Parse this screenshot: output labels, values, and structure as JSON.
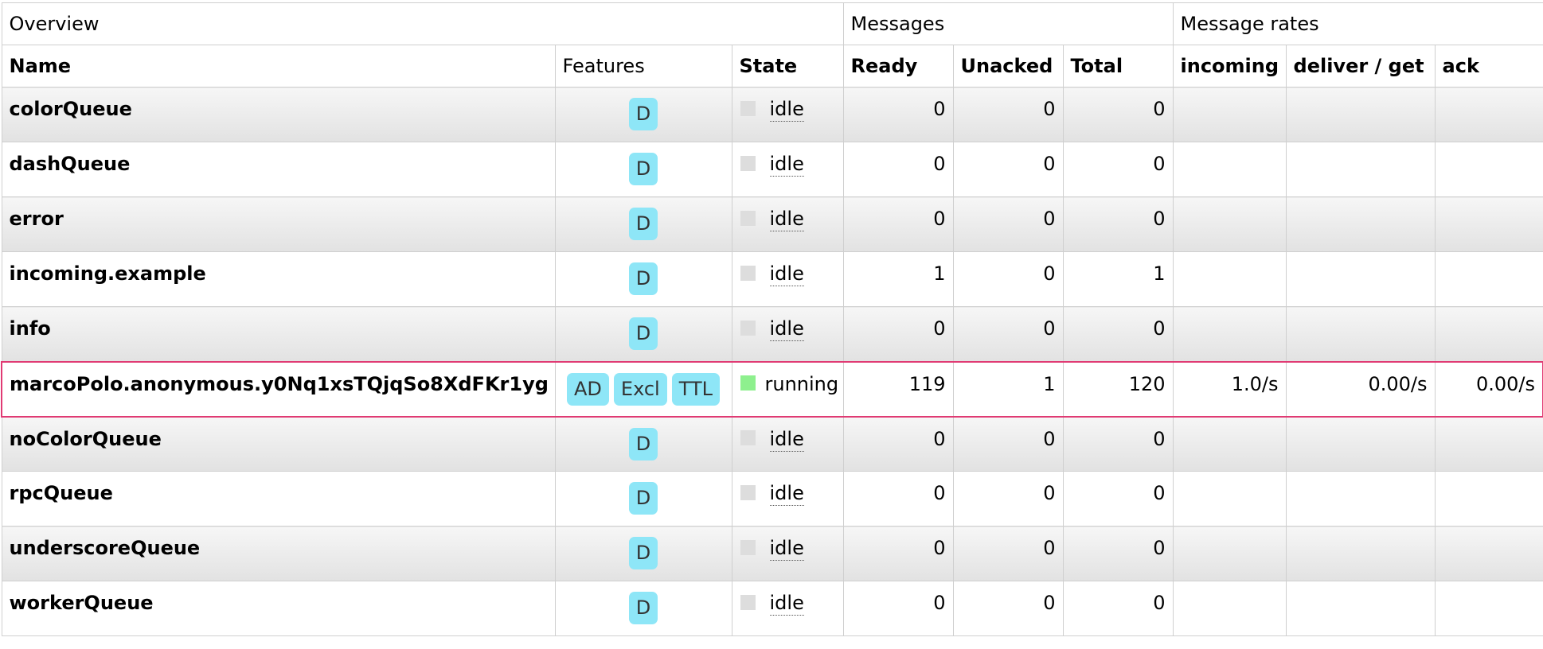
{
  "headers": {
    "groups": {
      "overview": "Overview",
      "messages": "Messages",
      "rates": "Message rates"
    },
    "columns": {
      "name": "Name",
      "features": "Features",
      "state": "State",
      "ready": "Ready",
      "unacked": "Unacked",
      "total": "Total",
      "incoming": "incoming",
      "deliver_get": "deliver / get",
      "ack": "ack"
    }
  },
  "colors": {
    "badge": "#8ee6f7",
    "idle_indicator": "#dddddd",
    "running_indicator": "#8ef08e",
    "selected_row_border": "#e03a73"
  },
  "queues": [
    {
      "name": "colorQueue",
      "features": [
        "D"
      ],
      "state": "idle",
      "ready": "0",
      "unacked": "0",
      "total": "0",
      "incoming": "",
      "deliver_get": "",
      "ack": ""
    },
    {
      "name": "dashQueue",
      "features": [
        "D"
      ],
      "state": "idle",
      "ready": "0",
      "unacked": "0",
      "total": "0",
      "incoming": "",
      "deliver_get": "",
      "ack": ""
    },
    {
      "name": "error",
      "features": [
        "D"
      ],
      "state": "idle",
      "ready": "0",
      "unacked": "0",
      "total": "0",
      "incoming": "",
      "deliver_get": "",
      "ack": ""
    },
    {
      "name": "incoming.example",
      "features": [
        "D"
      ],
      "state": "idle",
      "ready": "1",
      "unacked": "0",
      "total": "1",
      "incoming": "",
      "deliver_get": "",
      "ack": ""
    },
    {
      "name": "info",
      "features": [
        "D"
      ],
      "state": "idle",
      "ready": "0",
      "unacked": "0",
      "total": "0",
      "incoming": "",
      "deliver_get": "",
      "ack": ""
    },
    {
      "name": "marcoPolo.anonymous.y0Nq1xsTQjqSo8XdFKr1yg",
      "features": [
        "AD",
        "Excl",
        "TTL"
      ],
      "state": "running",
      "ready": "119",
      "unacked": "1",
      "total": "120",
      "incoming": "1.0/s",
      "deliver_get": "0.00/s",
      "ack": "0.00/s"
    },
    {
      "name": "noColorQueue",
      "features": [
        "D"
      ],
      "state": "idle",
      "ready": "0",
      "unacked": "0",
      "total": "0",
      "incoming": "",
      "deliver_get": "",
      "ack": ""
    },
    {
      "name": "rpcQueue",
      "features": [
        "D"
      ],
      "state": "idle",
      "ready": "0",
      "unacked": "0",
      "total": "0",
      "incoming": "",
      "deliver_get": "",
      "ack": ""
    },
    {
      "name": "underscoreQueue",
      "features": [
        "D"
      ],
      "state": "idle",
      "ready": "0",
      "unacked": "0",
      "total": "0",
      "incoming": "",
      "deliver_get": "",
      "ack": ""
    },
    {
      "name": "workerQueue",
      "features": [
        "D"
      ],
      "state": "idle",
      "ready": "0",
      "unacked": "0",
      "total": "0",
      "incoming": "",
      "deliver_get": "",
      "ack": ""
    }
  ]
}
